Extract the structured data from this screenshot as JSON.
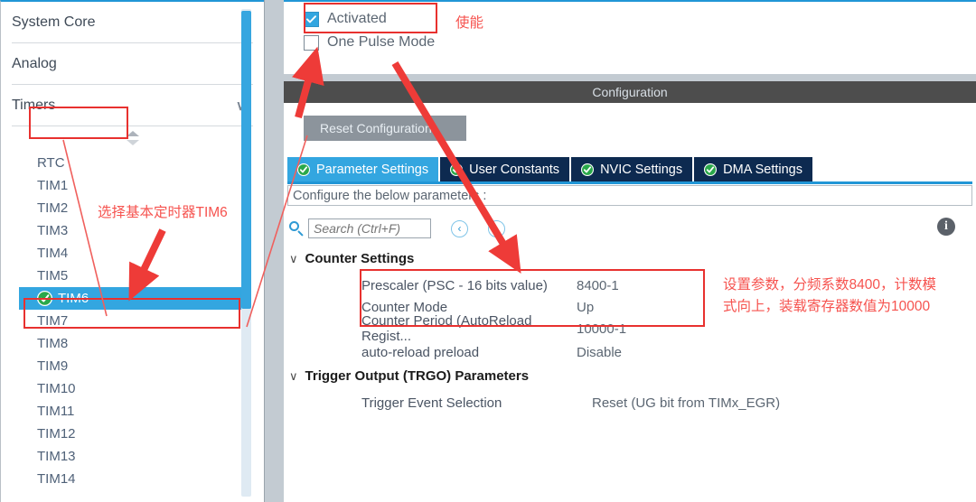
{
  "sidebar": {
    "categories": [
      {
        "label": "System Core",
        "chevron": "chevron-right",
        "glyph": "›"
      },
      {
        "label": "Analog",
        "chevron": "chevron-right",
        "glyph": "›"
      },
      {
        "label": "Timers",
        "chevron": "chevron-down",
        "glyph": "∨"
      }
    ],
    "peripherals": [
      {
        "label": "RTC",
        "selected": false,
        "checked": false
      },
      {
        "label": "TIM1",
        "selected": false,
        "checked": false
      },
      {
        "label": "TIM2",
        "selected": false,
        "checked": false
      },
      {
        "label": "TIM3",
        "selected": false,
        "checked": false
      },
      {
        "label": "TIM4",
        "selected": false,
        "checked": false
      },
      {
        "label": "TIM5",
        "selected": false,
        "checked": false
      },
      {
        "label": "TIM6",
        "selected": true,
        "checked": true
      },
      {
        "label": "TIM7",
        "selected": false,
        "checked": false
      },
      {
        "label": "TIM8",
        "selected": false,
        "checked": false
      },
      {
        "label": "TIM9",
        "selected": false,
        "checked": false
      },
      {
        "label": "TIM10",
        "selected": false,
        "checked": false
      },
      {
        "label": "TIM11",
        "selected": false,
        "checked": false
      },
      {
        "label": "TIM12",
        "selected": false,
        "checked": false
      },
      {
        "label": "TIM13",
        "selected": false,
        "checked": false
      },
      {
        "label": "TIM14",
        "selected": false,
        "checked": false
      }
    ]
  },
  "mode_panel": {
    "activated": {
      "label": "Activated",
      "checked": true
    },
    "one_pulse_mode": {
      "label": "One Pulse Mode",
      "checked": false
    }
  },
  "configuration": {
    "title": "Configuration",
    "reset_button": "Reset Configuration",
    "tabs": [
      {
        "label": "Parameter Settings",
        "active": true
      },
      {
        "label": "User Constants",
        "active": false
      },
      {
        "label": "NVIC Settings",
        "active": false
      },
      {
        "label": "DMA Settings",
        "active": false
      }
    ],
    "note": "Configure the below parameters :",
    "search": {
      "placeholder": "Search (Ctrl+F)",
      "value": ""
    },
    "nav_prev": "‹",
    "nav_next": "›",
    "info": "i",
    "groups": [
      {
        "title": "Counter Settings",
        "params": [
          {
            "name": "Prescaler (PSC - 16 bits value)",
            "value": "8400-1"
          },
          {
            "name": "Counter Mode",
            "value": "Up"
          },
          {
            "name": "Counter Period (AutoReload Regist...",
            "value": "10000-1"
          },
          {
            "name": "auto-reload preload",
            "value": "Disable"
          }
        ]
      },
      {
        "title": "Trigger Output (TRGO) Parameters",
        "params": [
          {
            "name": "Trigger Event Selection",
            "value": "Reset (UG bit from TIMx_EGR)"
          }
        ]
      }
    ]
  },
  "annotations": {
    "select_timer": "选择基本定时器TIM6",
    "enable": "使能",
    "params_line1": "设置参数，分频系数8400，计数模",
    "params_line2": "式向上，装载寄存器数值为10000",
    "color": "#f6534f"
  }
}
